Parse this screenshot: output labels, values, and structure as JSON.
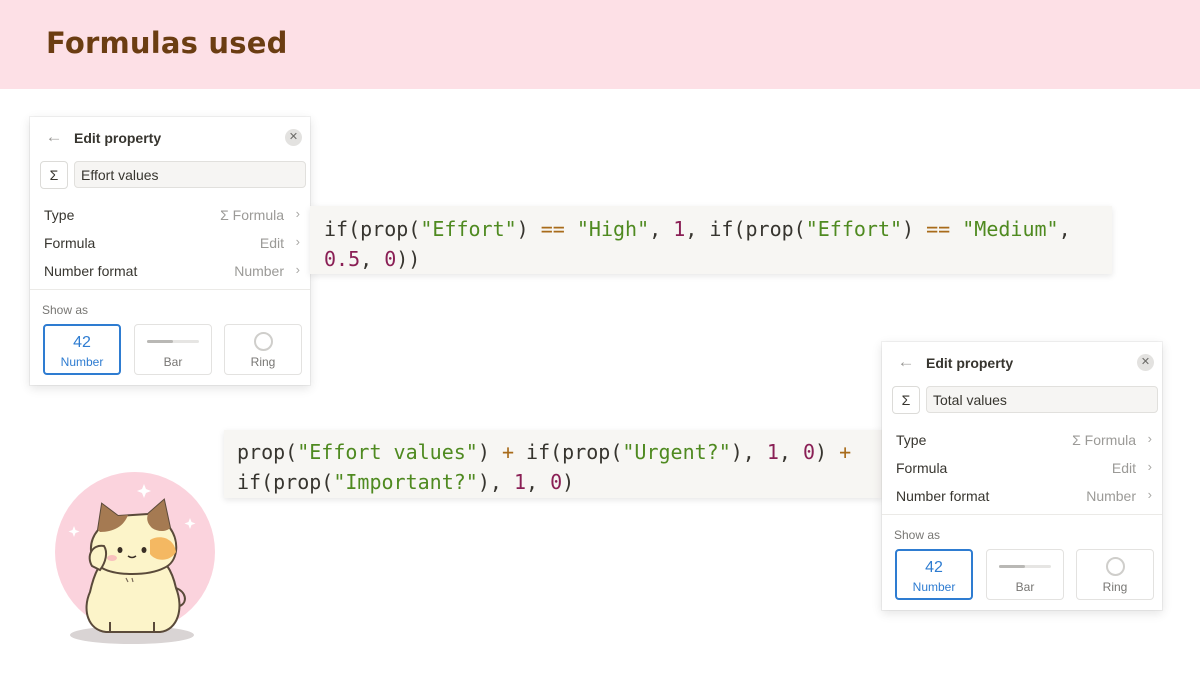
{
  "banner": {
    "title": "Formulas used"
  },
  "panels": [
    {
      "title": "Edit property",
      "back_icon": "arrow-left-icon",
      "close_icon": "close-icon",
      "sigma": "Σ",
      "name_value": "Effort values",
      "rows": [
        {
          "label": "Type",
          "value": "Σ Formula"
        },
        {
          "label": "Formula",
          "value": "Edit"
        },
        {
          "label": "Number format",
          "value": "Number"
        }
      ],
      "show_as_label": "Show as",
      "options": [
        {
          "sample": "42",
          "label": "Number",
          "selected": true
        },
        {
          "label": "Bar",
          "fill_fraction": 0.5
        },
        {
          "label": "Ring"
        }
      ]
    },
    {
      "title": "Edit property",
      "back_icon": "arrow-left-icon",
      "close_icon": "close-icon",
      "sigma": "Σ",
      "name_value": "Total values",
      "rows": [
        {
          "label": "Type",
          "value": "Σ Formula"
        },
        {
          "label": "Formula",
          "value": "Edit"
        },
        {
          "label": "Number format",
          "value": "Number"
        }
      ],
      "show_as_label": "Show as",
      "options": [
        {
          "sample": "42",
          "label": "Number",
          "selected": true
        },
        {
          "label": "Bar",
          "fill_fraction": 0.5
        },
        {
          "label": "Ring"
        }
      ]
    }
  ],
  "code_blocks": [
    {
      "lines": [
        [
          {
            "t": "if(prop(",
            "c": "txt"
          },
          {
            "t": "\"Effort\"",
            "c": "str"
          },
          {
            "t": ") ",
            "c": "txt"
          },
          {
            "t": "==",
            "c": "op"
          },
          {
            "t": " ",
            "c": "txt"
          },
          {
            "t": "\"High\"",
            "c": "str"
          },
          {
            "t": ", ",
            "c": "txt"
          },
          {
            "t": "1",
            "c": "num"
          },
          {
            "t": ", if(prop(",
            "c": "txt"
          },
          {
            "t": "\"Effort\"",
            "c": "str"
          },
          {
            "t": ") ",
            "c": "txt"
          },
          {
            "t": "==",
            "c": "op"
          },
          {
            "t": " ",
            "c": "txt"
          },
          {
            "t": "\"Medium\"",
            "c": "str"
          },
          {
            "t": ",",
            "c": "txt"
          }
        ],
        [
          {
            "t": "0.5",
            "c": "num"
          },
          {
            "t": ", ",
            "c": "txt"
          },
          {
            "t": "0",
            "c": "num"
          },
          {
            "t": "))",
            "c": "txt"
          }
        ]
      ]
    },
    {
      "lines": [
        [
          {
            "t": "prop(",
            "c": "txt"
          },
          {
            "t": "\"Effort values\"",
            "c": "str"
          },
          {
            "t": ") ",
            "c": "txt"
          },
          {
            "t": "+",
            "c": "op"
          },
          {
            "t": " if(prop(",
            "c": "txt"
          },
          {
            "t": "\"Urgent?\"",
            "c": "str"
          },
          {
            "t": "), ",
            "c": "txt"
          },
          {
            "t": "1",
            "c": "num"
          },
          {
            "t": ", ",
            "c": "txt"
          },
          {
            "t": "0",
            "c": "num"
          },
          {
            "t": ") ",
            "c": "txt"
          },
          {
            "t": "+",
            "c": "op"
          }
        ],
        [
          {
            "t": "if(prop(",
            "c": "txt"
          },
          {
            "t": "\"Important?\"",
            "c": "str"
          },
          {
            "t": "), ",
            "c": "txt"
          },
          {
            "t": "1",
            "c": "num"
          },
          {
            "t": ", ",
            "c": "txt"
          },
          {
            "t": "0",
            "c": "num"
          },
          {
            "t": ")",
            "c": "txt"
          }
        ]
      ]
    }
  ],
  "illustration": {
    "icon": "cat-illustration"
  },
  "colors": {
    "banner_bg": "#fde0e6",
    "title": "#6b3d12",
    "accent": "#2e7cd1",
    "string_token": "#4f8a20",
    "number_token": "#8a1f55",
    "operator_token": "#a86b1a"
  }
}
